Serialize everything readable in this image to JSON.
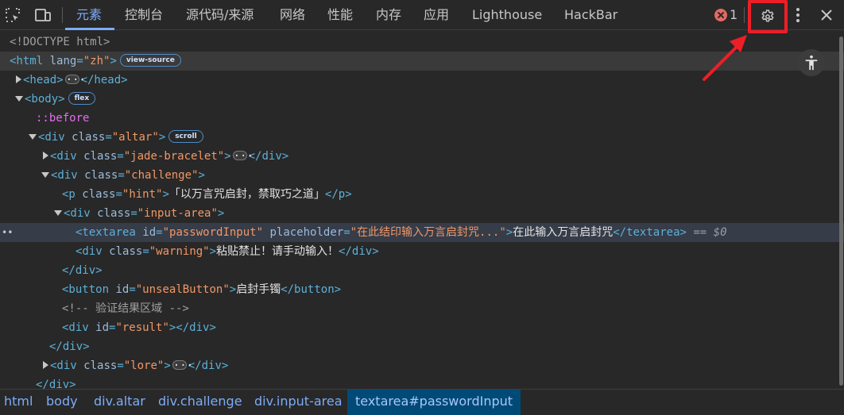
{
  "toolbar": {
    "tabs": [
      "元素",
      "控制台",
      "源代码/来源",
      "网络",
      "性能",
      "内存",
      "应用",
      "Lighthouse",
      "HackBar"
    ],
    "error_count": "1",
    "icons": {
      "inspect": "inspect-element-icon",
      "device": "device-toggle-icon",
      "error": "error-circle-icon",
      "settings": "gear-icon",
      "menu": "more-vertical-icon",
      "close": "close-icon"
    }
  },
  "tree": {
    "doctype": "<!DOCTYPE html>",
    "html_attr_name": "lang",
    "html_attr_value": "\"zh\"",
    "badge_view_source": "view-source",
    "badge_flex": "flex",
    "badge_scroll": "scroll",
    "pseudo_before": "::before",
    "altar_class": "\"altar\"",
    "jade_class": "\"jade-bracelet\"",
    "challenge_class": "\"challenge\"",
    "hint_class": "\"hint\"",
    "hint_text": "「以万言咒启封，禁取巧之道」",
    "input_area_class": "\"input-area\"",
    "textarea_id": "\"passwordInput\"",
    "textarea_placeholder": "\"在此结印输入万言启封咒...\"",
    "textarea_text": "在此输入万言启封咒",
    "selected_marker": "== $0",
    "warning_class": "\"warning\"",
    "warning_text": "粘贴禁止！请手动输入！",
    "button_id": "\"unsealButton\"",
    "button_text": "启封手镯",
    "comment": "<!-- 验证结果区域 -->",
    "result_id": "\"result\"",
    "lore_class": "\"lore\""
  },
  "breadcrumb": [
    "html",
    "body",
    "div.altar",
    "div.challenge",
    "div.input-area",
    "textarea#passwordInput"
  ],
  "colors": {
    "accent": "#7cacf8",
    "highlight_box": "#ee1e26",
    "tag": "#5db0d7",
    "attr_value": "#f29766"
  }
}
